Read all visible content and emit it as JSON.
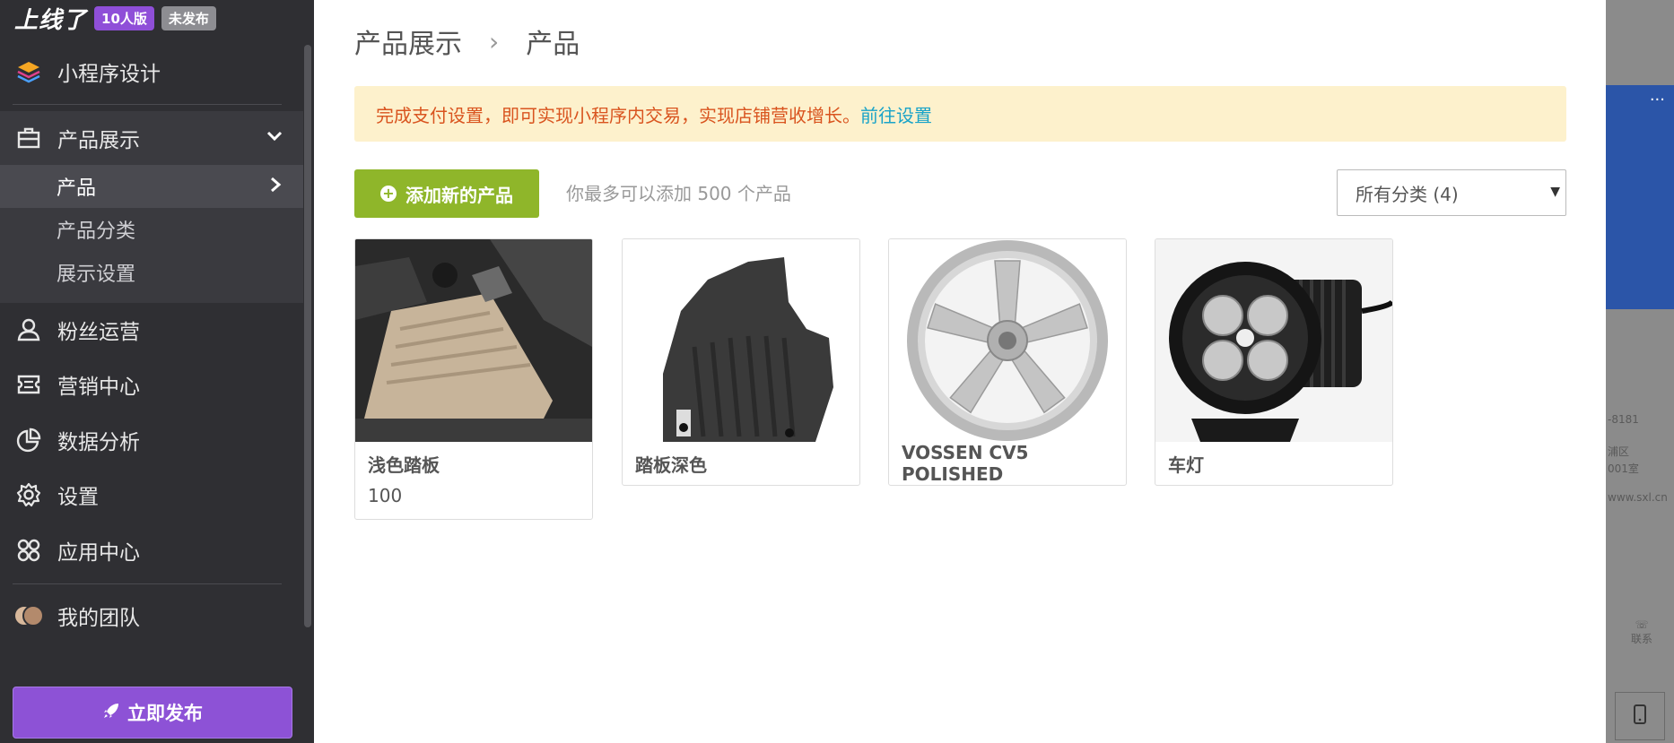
{
  "brand": {
    "logo": "上线了",
    "plan_badge": "10人版",
    "status_badge": "未发布"
  },
  "sidebar": {
    "design": "小程序设计",
    "products_group": "产品展示",
    "sub_items": [
      "产品",
      "产品分类",
      "展示设置"
    ],
    "fans": "粉丝运营",
    "marketing": "营销中心",
    "analytics": "数据分析",
    "settings": "设置",
    "apps": "应用中心",
    "team": "我的团队",
    "publish_label": "立即发布"
  },
  "breadcrumb": {
    "parent": "产品展示",
    "separator": "›",
    "current": "产品"
  },
  "notice": {
    "text": "完成支付设置，即可实现小程序内交易，实现店铺营收增长。",
    "link": "前往设置"
  },
  "toolbar": {
    "add_label": "添加新的产品",
    "limit_text": "你最多可以添加 500 个产品",
    "category_select": "所有分类 (4)"
  },
  "products": [
    {
      "name": "浅色踏板",
      "price": "100"
    },
    {
      "name": "踏板深色"
    },
    {
      "name": "VOSSEN CV5 POLISHED"
    },
    {
      "name": "车灯"
    }
  ],
  "background_app": {
    "phone_fragment": "-8181",
    "address_line1": "浦区",
    "address_line2": "001室",
    "url_fragment": "www.sxl.cn",
    "contact_label": "联系"
  },
  "colors": {
    "sidebar_bg": "#2f2f33",
    "publish_purple": "#8d52d6",
    "add_green": "#8fb62a",
    "notice_bg": "#fdf1cc",
    "notice_text": "#d9541f",
    "link_blue": "#19a3c8"
  }
}
